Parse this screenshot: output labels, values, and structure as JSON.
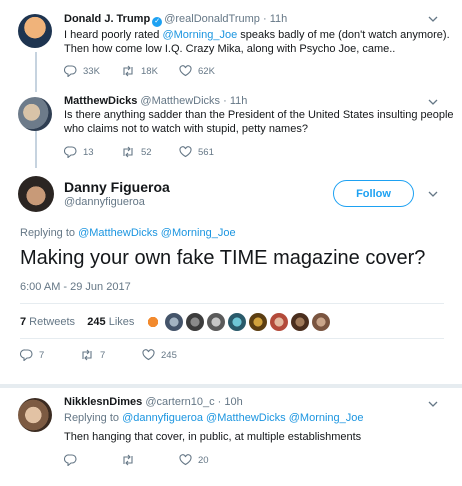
{
  "tweet1": {
    "name": "Donald J. Trump",
    "handle": "@realDonaldTrump",
    "sep": "·",
    "time": "11h",
    "line1_pre": "I heard poorly rated ",
    "line1_link": "@Morning_Joe",
    "line1_post": " speaks badly of me (don't watch anymore).",
    "line2": "Then how come low I.Q. Crazy Mika, along with Psycho Joe, came..",
    "replies": "33K",
    "retweets": "18K",
    "likes": "62K"
  },
  "tweet2": {
    "name": "MatthewDicks",
    "handle": "@MatthewDicks",
    "sep": "·",
    "time": "11h",
    "line1": "Is there anything sadder than the President of the United States insulting people",
    "line2": "who claims not to watch with stupid, petty names?",
    "replies": "13",
    "retweets": "52",
    "likes": "561"
  },
  "main": {
    "name": "Danny Figueroa",
    "handle": "@dannyfigueroa",
    "follow_label": "Follow",
    "replying_to_label": "Replying to ",
    "replying_to_1": "@MatthewDicks",
    "replying_to_2": "@Morning_Joe",
    "text": "Making your own fake TIME magazine cover?",
    "timestamp": "6:00 AM - 29 Jun 2017",
    "retweets_count": "7",
    "retweets_label": " Retweets",
    "likes_count": "245",
    "likes_label": " Likes",
    "replies": "7",
    "retweets": "7",
    "likes": "245"
  },
  "reply": {
    "name": "NikklesnDimes",
    "handle": "@cartern10_c",
    "sep": "·",
    "time": "10h",
    "replying_to_label": "Replying to ",
    "replying_to_1": "@dannyfigueroa",
    "replying_to_2": "@MatthewDicks",
    "replying_to_3": "@Morning_Joe",
    "text": "Then hanging that cover, in public, at multiple establishments",
    "likes": "20"
  },
  "colors": {
    "accent": "#1da1f2",
    "link": "#1b95e0",
    "muted": "#657786"
  }
}
